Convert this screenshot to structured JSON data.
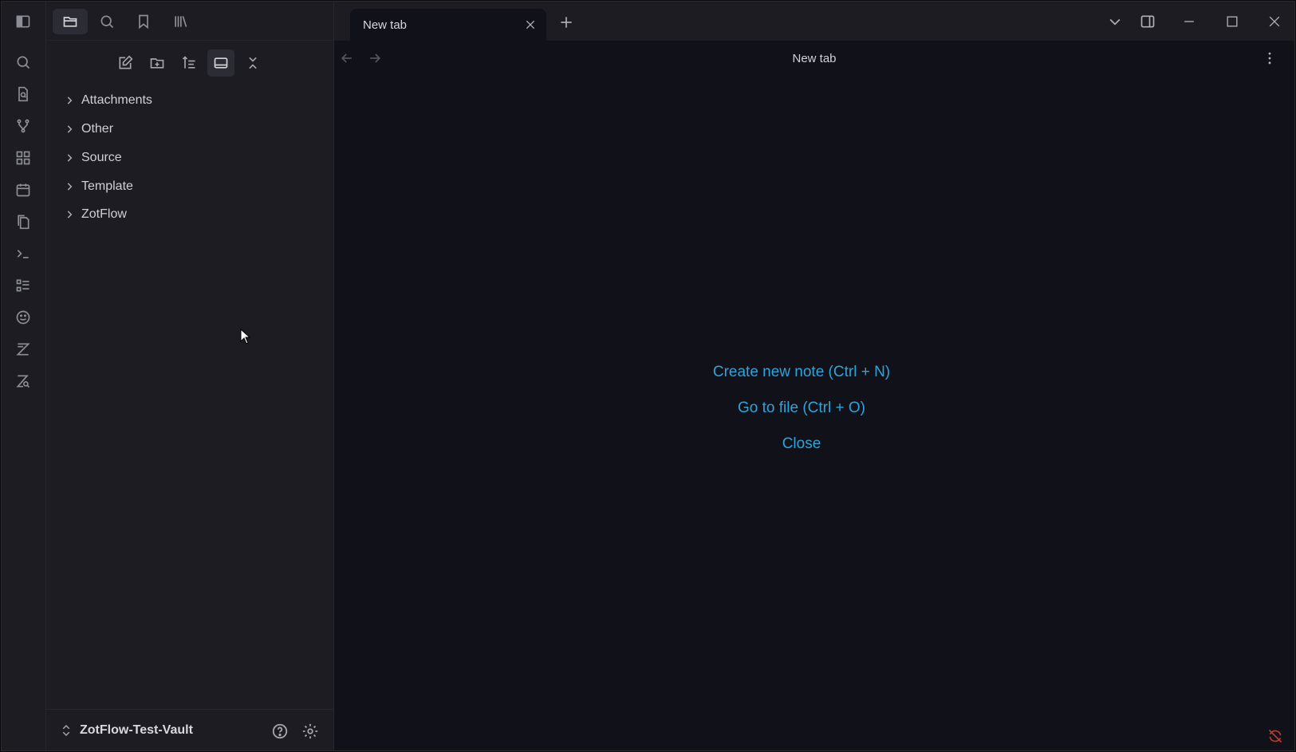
{
  "sidebar": {
    "folders": [
      "Attachments",
      "Other",
      "Source",
      "Template",
      "ZotFlow"
    ]
  },
  "tabs": [
    {
      "label": "New tab",
      "active": true
    }
  ],
  "view": {
    "title": "New tab",
    "actions": {
      "create": "Create new note (Ctrl + N)",
      "goto": "Go to file (Ctrl + O)",
      "close": "Close"
    }
  },
  "vault": {
    "name": "ZotFlow-Test-Vault"
  },
  "colors": {
    "accent": "#2fa4d9",
    "background": "#111119",
    "sidebar": "#1c1c22",
    "error": "#c0392b"
  }
}
